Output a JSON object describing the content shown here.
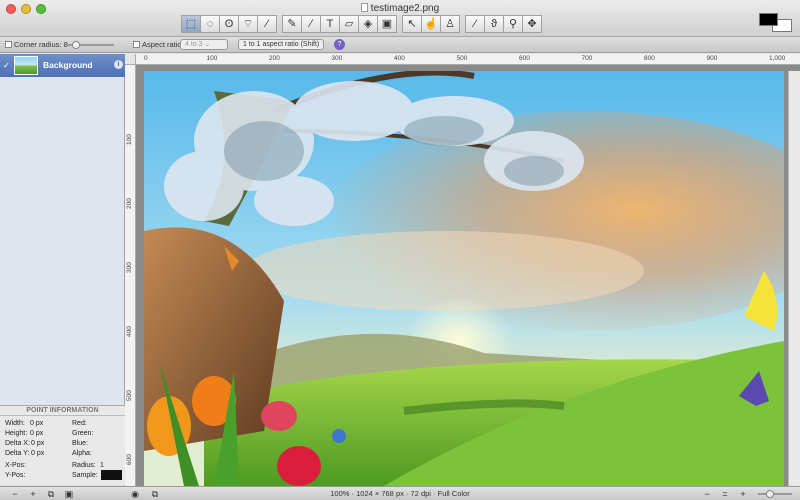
{
  "window": {
    "title": "testimage2.png",
    "traffic_lights": {
      "close": "#fc5b57",
      "minimize": "#e5bf3c",
      "zoom": "#57c038"
    }
  },
  "toolbar": {
    "tools": [
      {
        "name": "rect-select-tool",
        "glyph": "⬚",
        "selected": true
      },
      {
        "name": "ellipse-select-tool",
        "glyph": "◌"
      },
      {
        "name": "lasso-tool",
        "glyph": "ʘ"
      },
      {
        "name": "polygon-lasso-tool",
        "glyph": "⌔"
      },
      {
        "name": "magic-wand-tool",
        "glyph": "⁄"
      },
      {
        "name": "pencil-tool",
        "glyph": "✎",
        "gap": true
      },
      {
        "name": "brush-tool",
        "glyph": "∕"
      },
      {
        "name": "text-tool",
        "glyph": "T"
      },
      {
        "name": "eraser-tool",
        "glyph": "▱"
      },
      {
        "name": "paint-bucket-tool",
        "glyph": "◈"
      },
      {
        "name": "gradient-tool",
        "glyph": "▣"
      },
      {
        "name": "move-selection-tool",
        "glyph": "↖",
        "gap": true
      },
      {
        "name": "move-layer-tool",
        "glyph": "☝"
      },
      {
        "name": "stamp-tool",
        "glyph": "♙"
      },
      {
        "name": "eyedropper-tool",
        "glyph": "⁄",
        "gap": true
      },
      {
        "name": "smudge-tool",
        "glyph": "ϑ"
      },
      {
        "name": "zoom-tool",
        "glyph": "⚲"
      },
      {
        "name": "pan-tool",
        "glyph": "✥"
      }
    ]
  },
  "options": {
    "corner_radius_label": "Corner radius:",
    "corner_radius_value": "8",
    "aspect_ratio_label": "Aspect ratio:",
    "aspect_ratio_value": "4 to 3",
    "aspect_preset": "1 to 1 aspect ratio (Shift)",
    "help": "?"
  },
  "layers": [
    {
      "name": "Background",
      "visible": "✓",
      "info": "i"
    }
  ],
  "point_info": {
    "header": "POINT INFORMATION",
    "width": "Width:",
    "width_v": "0 px",
    "height": "Height:",
    "height_v": "0 px",
    "dx": "Delta X:",
    "dx_v": "0 px",
    "dy": "Delta Y:",
    "dy_v": "0 px",
    "xpos": "X-Pos:",
    "ypos": "Y-Pos:",
    "red": "Red:",
    "green": "Green:",
    "blue": "Blue:",
    "alpha": "Alpha:",
    "radius": "Radius:",
    "radius_v": "1",
    "sample": "Sample:"
  },
  "bottom": {
    "minus": "−",
    "add_layer": "+",
    "dup_layer": "⧉",
    "layer_opts": "▣",
    "eye": "◉",
    "crop": "⧉",
    "status": "100% · 1024 × 768 px · 72 dpi · Full Color",
    "zoom_out": "−",
    "zoom_fit": "=",
    "zoom_in": "+"
  },
  "ruler_h": [
    "0",
    "100",
    "200",
    "300",
    "400",
    "500",
    "600",
    "700",
    "800",
    "900",
    "1,000"
  ],
  "ruler_v": [
    "100",
    "200",
    "300",
    "400",
    "500",
    "600"
  ],
  "colors": {
    "selection": "#4d71b5",
    "sky": "#6cc7ef",
    "grass": "#6fbe32"
  }
}
